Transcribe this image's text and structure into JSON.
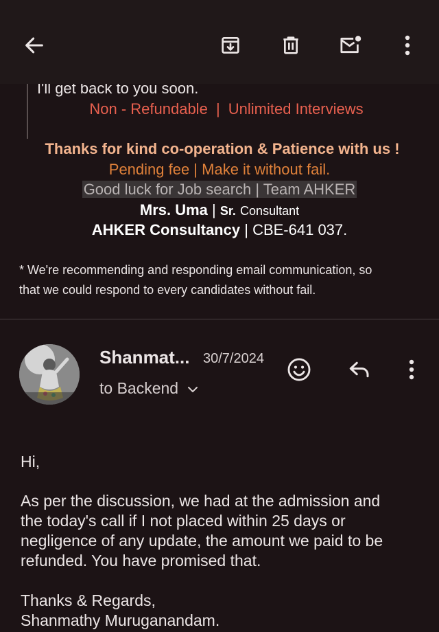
{
  "toolbar": {
    "back_icon": "arrow-left-icon",
    "archive_icon": "archive-icon",
    "delete_icon": "trash-icon",
    "mark_unread_icon": "mail-unread-icon",
    "more_icon": "more-vert-icon"
  },
  "previous_message": {
    "quoted_line": "I'll get back to you soon.",
    "terms_left": "Non - Refundable",
    "terms_sep": "|",
    "terms_right": "Unlimited Interviews",
    "thanks": "Thanks for kind co-operation & Patience with us !",
    "pending": "Pending fee | Make it without fail.",
    "good_luck": "Good luck for Job search  |  Team AHKER",
    "sig_name": "Mrs. Uma",
    "sig_sep": "|",
    "sig_role": "Sr.",
    "sig_role_rest": "Consultant",
    "company": "AHKER Consultancy",
    "company_sep": "|",
    "company_code": "CBE-641 037.",
    "note_line1": "* We're recommending and responding email communication, so",
    "note_line2": "that we could respond to every candidates without fail."
  },
  "message": {
    "sender": "Shanmat...",
    "date": "30/7/2024",
    "recipient": "to Backend",
    "greeting": "Hi,",
    "body_lines": [
      "As per the discussion, we had at the admission and",
      "the today's call if I not placed within 25 days or",
      "negligence of any update, the amount we paid to be",
      "refunded. You have promised that."
    ],
    "closing": "Thanks & Regards,",
    "signature": "Shanmathy Muruganandam."
  },
  "colors": {
    "terms": "#e8604f",
    "thanks": "#f3b48e",
    "pending": "#e0813a",
    "highlight_bg": "#3a3536"
  }
}
